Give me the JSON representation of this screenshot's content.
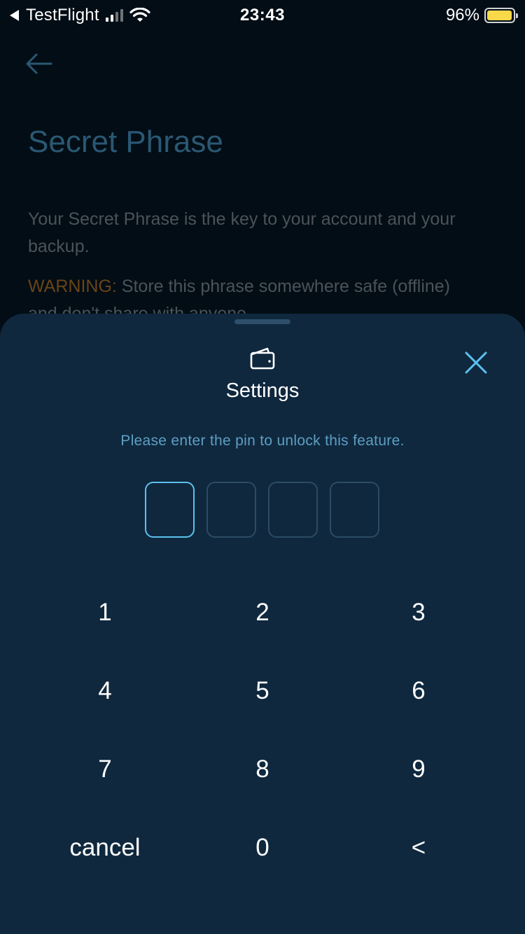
{
  "status_bar": {
    "back_app": "TestFlight",
    "time": "23:43",
    "battery_percent": "96%",
    "battery_level": 0.96,
    "signal_bars_active": 2,
    "signal_bars_total": 4
  },
  "page": {
    "back_icon": "arrow-left-icon",
    "title": "Secret Phrase",
    "description": "Your Secret Phrase is the key to your account and your backup.",
    "warning_label": "WARNING:",
    "warning_text": " Store this phrase somewhere safe (offline) and don't share with anyone."
  },
  "sheet": {
    "icon": "wallet-icon",
    "title": "Settings",
    "close_icon": "close-icon",
    "prompt": "Please enter the pin to unlock this feature.",
    "pin_length": 4,
    "pin_active_index": 0,
    "keypad": [
      [
        "1",
        "2",
        "3"
      ],
      [
        "4",
        "5",
        "6"
      ],
      [
        "7",
        "8",
        "9"
      ],
      [
        "cancel",
        "0",
        "<"
      ]
    ]
  },
  "colors": {
    "background": "#020d15",
    "sheet": "#0f283e",
    "accent": "#5bc1ee",
    "prompt": "#5d9fc3",
    "warning": "#6a4416"
  }
}
